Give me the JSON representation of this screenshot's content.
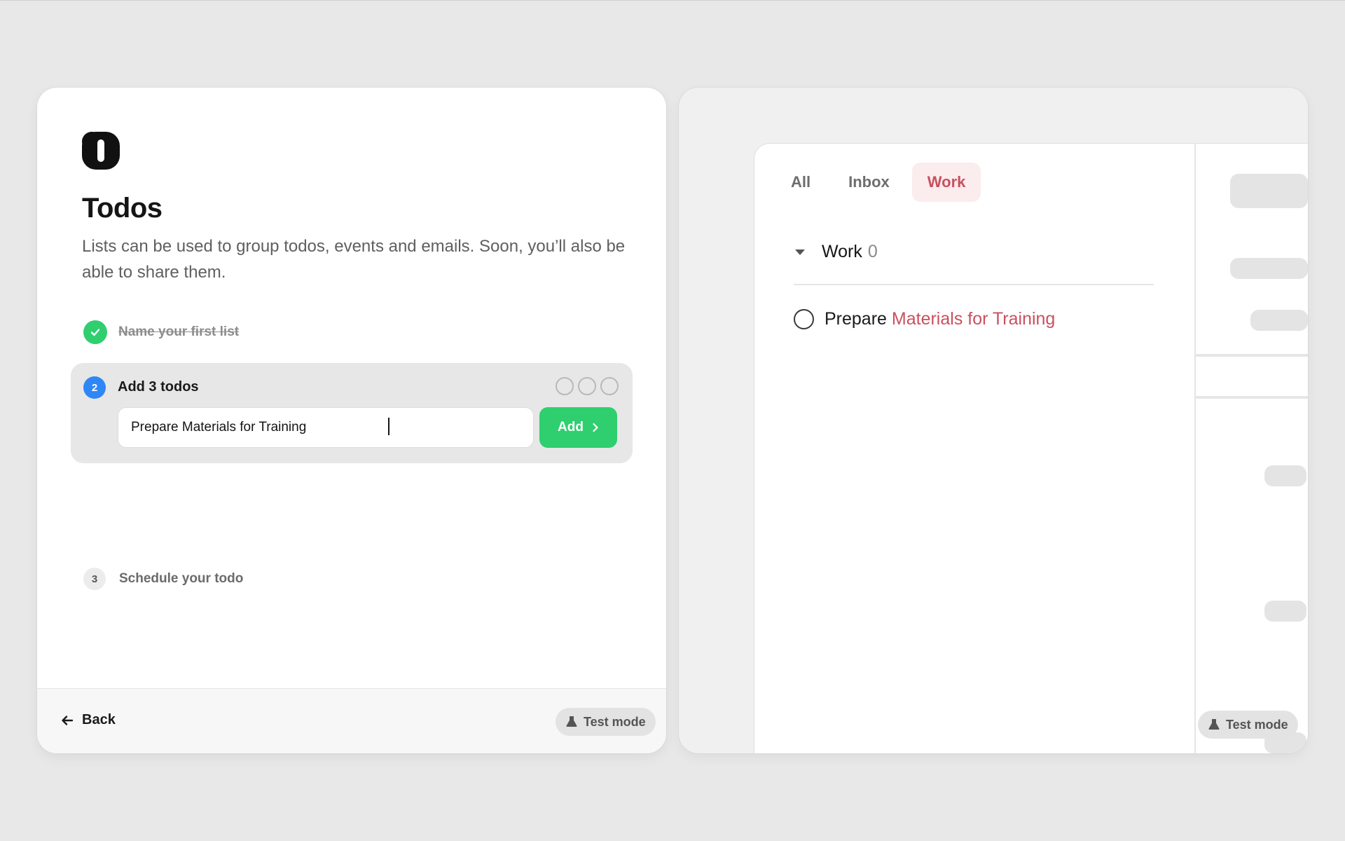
{
  "onboarding": {
    "title": "Todos",
    "description": "Lists can be used to group todos, events and emails. Soon, you’ll also be able to share them.",
    "steps": [
      {
        "number": "1",
        "label": "Name your first list",
        "status": "completed"
      },
      {
        "number": "2",
        "label": "Add 3 todos",
        "status": "active"
      },
      {
        "number": "3",
        "label": "Schedule your todo",
        "status": "pending"
      }
    ],
    "todos_added": 0,
    "todos_required": 3,
    "input_value": "Prepare Materials for Training",
    "add_label": "Add",
    "back_label": "Back",
    "test_mode_label": "Test mode"
  },
  "preview": {
    "tabs": [
      {
        "label": "All",
        "active": false
      },
      {
        "label": "Inbox",
        "active": false
      },
      {
        "label": "Work",
        "active": true
      }
    ],
    "group": {
      "title": "Work",
      "count": "0"
    },
    "todo": {
      "prefix": "Prepare",
      "highlight": "Materials for Training"
    },
    "test_mode_label": "Test mode"
  },
  "colors": {
    "success": "#2fcf6f",
    "step_active": "#2f86f6",
    "accent": "#c9505f",
    "accent_bg": "#fbeced"
  }
}
